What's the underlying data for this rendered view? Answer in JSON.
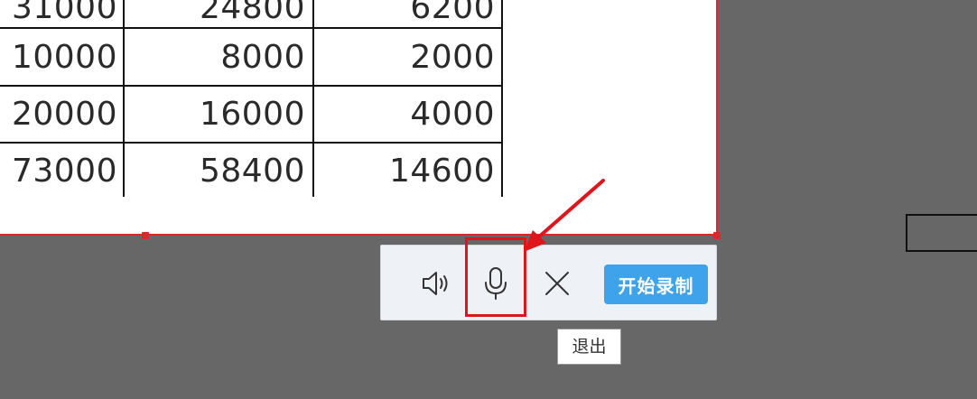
{
  "table": {
    "rows": [
      [
        "31000",
        "24800",
        "6200"
      ],
      [
        "10000",
        "8000",
        "2000"
      ],
      [
        "20000",
        "16000",
        "4000"
      ],
      [
        "73000",
        "58400",
        "14600"
      ]
    ]
  },
  "toolbar": {
    "speaker_icon": "speaker-icon",
    "mic_icon": "microphone-icon",
    "close_icon": "close-icon",
    "start_label": "开始录制",
    "accent_color": "#3ea3ea"
  },
  "tooltip": {
    "text": "退出"
  },
  "colors": {
    "selection_border": "#d9292d",
    "highlight": "#e0151b",
    "overlay": "#676767"
  }
}
